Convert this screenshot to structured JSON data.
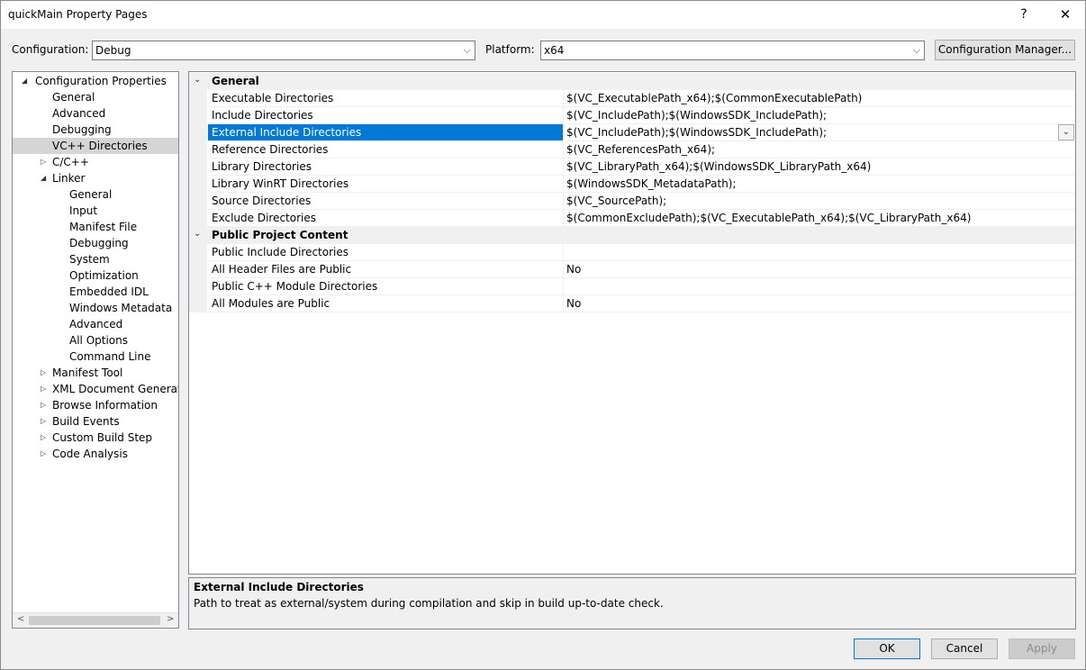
{
  "window": {
    "title": "quickMain Property Pages",
    "help_glyph": "?",
    "close_glyph": "✕"
  },
  "config_bar": {
    "configuration_label": "Configuration:",
    "configuration_value": "Debug",
    "platform_label": "Platform:",
    "platform_value": "x64",
    "config_manager_label": "Configuration Manager..."
  },
  "tree": {
    "items": [
      {
        "label": "Configuration Properties",
        "expander": "◢",
        "level": 0
      },
      {
        "label": "General",
        "expander": "",
        "level": 1
      },
      {
        "label": "Advanced",
        "expander": "",
        "level": 1
      },
      {
        "label": "Debugging",
        "expander": "",
        "level": 1
      },
      {
        "label": "VC++ Directories",
        "expander": "",
        "level": 1,
        "selected": true
      },
      {
        "label": "C/C++",
        "expander": "▷",
        "level": 1
      },
      {
        "label": "Linker",
        "expander": "◢",
        "level": 1
      },
      {
        "label": "General",
        "expander": "",
        "level": 2
      },
      {
        "label": "Input",
        "expander": "",
        "level": 2
      },
      {
        "label": "Manifest File",
        "expander": "",
        "level": 2
      },
      {
        "label": "Debugging",
        "expander": "",
        "level": 2
      },
      {
        "label": "System",
        "expander": "",
        "level": 2
      },
      {
        "label": "Optimization",
        "expander": "",
        "level": 2
      },
      {
        "label": "Embedded IDL",
        "expander": "",
        "level": 2
      },
      {
        "label": "Windows Metadata",
        "expander": "",
        "level": 2
      },
      {
        "label": "Advanced",
        "expander": "",
        "level": 2
      },
      {
        "label": "All Options",
        "expander": "",
        "level": 2
      },
      {
        "label": "Command Line",
        "expander": "",
        "level": 2
      },
      {
        "label": "Manifest Tool",
        "expander": "▷",
        "level": 1
      },
      {
        "label": "XML Document Generator",
        "expander": "▷",
        "level": 1
      },
      {
        "label": "Browse Information",
        "expander": "▷",
        "level": 1
      },
      {
        "label": "Build Events",
        "expander": "▷",
        "level": 1
      },
      {
        "label": "Custom Build Step",
        "expander": "▷",
        "level": 1
      },
      {
        "label": "Code Analysis",
        "expander": "▷",
        "level": 1
      }
    ],
    "scroll_left": "<",
    "scroll_right": ">"
  },
  "grid": {
    "categories": [
      {
        "name": "General",
        "expander": "⌄",
        "rows": [
          {
            "name": "Executable Directories",
            "value": "$(VC_ExecutablePath_x64);$(CommonExecutablePath)"
          },
          {
            "name": "Include Directories",
            "value": "$(VC_IncludePath);$(WindowsSDK_IncludePath);"
          },
          {
            "name": "External Include Directories",
            "value": "$(VC_IncludePath);$(WindowsSDK_IncludePath);",
            "selected": true
          },
          {
            "name": "Reference Directories",
            "value": "$(VC_ReferencesPath_x64);"
          },
          {
            "name": "Library Directories",
            "value": "$(VC_LibraryPath_x64);$(WindowsSDK_LibraryPath_x64)"
          },
          {
            "name": "Library WinRT Directories",
            "value": "$(WindowsSDK_MetadataPath);"
          },
          {
            "name": "Source Directories",
            "value": "$(VC_SourcePath);"
          },
          {
            "name": "Exclude Directories",
            "value": "$(CommonExcludePath);$(VC_ExecutablePath_x64);$(VC_LibraryPath_x64)"
          }
        ]
      },
      {
        "name": "Public Project Content",
        "expander": "⌄",
        "rows": [
          {
            "name": "Public Include Directories",
            "value": ""
          },
          {
            "name": "All Header Files are Public",
            "value": "No"
          },
          {
            "name": "Public C++ Module Directories",
            "value": ""
          },
          {
            "name": "All Modules are Public",
            "value": "No"
          }
        ]
      }
    ],
    "dropdown_glyph": "⌄"
  },
  "description": {
    "title": "External Include Directories",
    "text": "Path to treat as external/system during compilation and skip in build up-to-date check."
  },
  "buttons": {
    "ok": "OK",
    "cancel": "Cancel",
    "apply": "Apply"
  }
}
